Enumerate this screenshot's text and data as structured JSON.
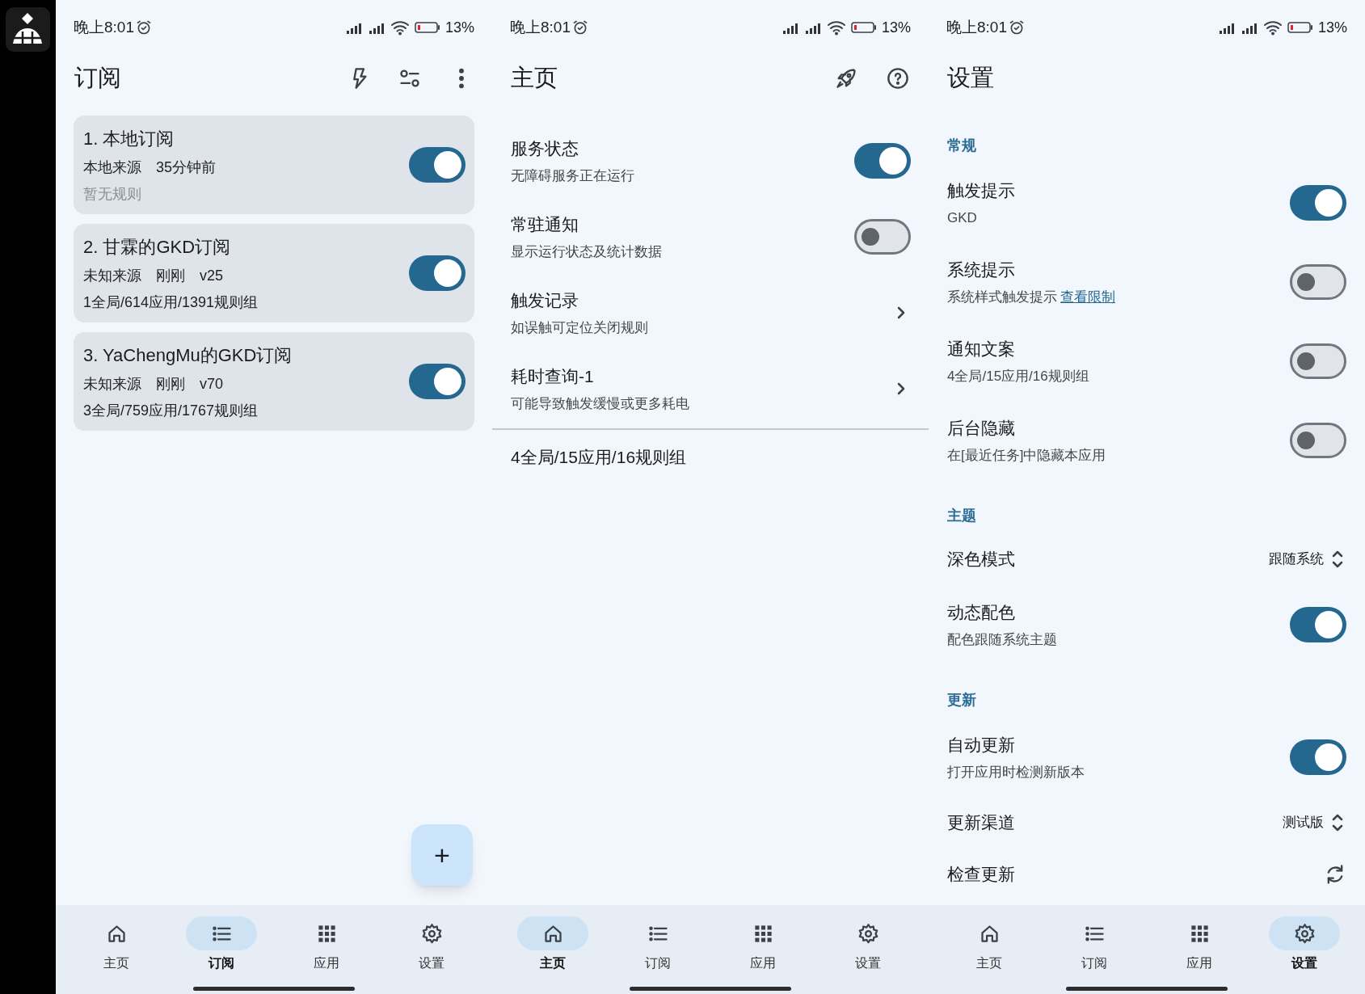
{
  "panels": [
    {
      "kind": "subscriptions",
      "status_bar": {
        "time": "晚上8:01",
        "battery": "13%"
      },
      "title": "订阅",
      "cards": [
        {
          "title": "1. 本地订阅",
          "meta": [
            "本地来源",
            "35分钟前"
          ],
          "detail": "暂无规则",
          "rules_empty": true,
          "on": true
        },
        {
          "title": "2. 甘霖的GKD订阅",
          "meta": [
            "未知来源",
            "刚刚",
            "v25"
          ],
          "detail": "1全局/614应用/1391规则组",
          "rules_empty": false,
          "on": true
        },
        {
          "title": "3. YaChengMu的GKD订阅",
          "meta": [
            "未知来源",
            "刚刚",
            "v70"
          ],
          "detail": "3全局/759应用/1767规则组",
          "rules_empty": false,
          "on": true
        }
      ],
      "fab": "+",
      "nav": [
        {
          "label": "主页",
          "selected": false
        },
        {
          "label": "订阅",
          "selected": true
        },
        {
          "label": "应用",
          "selected": false
        },
        {
          "label": "设置",
          "selected": false
        }
      ]
    },
    {
      "kind": "home",
      "status_bar": {
        "time": "晚上8:01",
        "battery": "13%"
      },
      "title": "主页",
      "items": [
        {
          "kind": "switch",
          "label": "服务状态",
          "subtitle": "无障碍服务正在运行",
          "on": true
        },
        {
          "kind": "switch",
          "label": "常驻通知",
          "subtitle": "显示运行状态及统计数据",
          "on": false
        },
        {
          "kind": "link",
          "label": "触发记录",
          "subtitle": "如误触可定位关闭规则"
        },
        {
          "kind": "link",
          "label": "耗时查询-1",
          "subtitle": "可能导致触发缓慢或更多耗电"
        }
      ],
      "summary": "4全局/15应用/16规则组",
      "nav": [
        {
          "label": "主页",
          "selected": true
        },
        {
          "label": "订阅",
          "selected": false
        },
        {
          "label": "应用",
          "selected": false
        },
        {
          "label": "设置",
          "selected": false
        }
      ]
    },
    {
      "kind": "settings",
      "status_bar": {
        "time": "晚上8:01",
        "battery": "13%"
      },
      "title": "设置",
      "items": [
        {
          "kind": "section",
          "label": "常规"
        },
        {
          "kind": "switch",
          "label": "触发提示",
          "subtitle": "GKD",
          "on": true
        },
        {
          "kind": "switch",
          "label": "系统提示",
          "subtitle": "系统样式触发提示",
          "link": "查看限制",
          "on": false
        },
        {
          "kind": "switch",
          "label": "通知文案",
          "subtitle": "4全局/15应用/16规则组",
          "on": false
        },
        {
          "kind": "switch",
          "label": "后台隐藏",
          "subtitle": "在[最近任务]中隐藏本应用",
          "on": false
        },
        {
          "kind": "section",
          "label": "主题"
        },
        {
          "kind": "select",
          "label": "深色模式",
          "value": "跟随系统"
        },
        {
          "kind": "switch",
          "label": "动态配色",
          "subtitle": "配色跟随系统主题",
          "on": true
        },
        {
          "kind": "section",
          "label": "更新"
        },
        {
          "kind": "switch",
          "label": "自动更新",
          "subtitle": "打开应用时检测新版本",
          "on": true
        },
        {
          "kind": "select",
          "label": "更新渠道",
          "value": "测试版"
        },
        {
          "kind": "action",
          "label": "检查更新"
        }
      ],
      "nav": [
        {
          "label": "主页",
          "selected": false
        },
        {
          "label": "订阅",
          "selected": false
        },
        {
          "label": "应用",
          "selected": false
        },
        {
          "label": "设置",
          "selected": true
        }
      ]
    }
  ]
}
